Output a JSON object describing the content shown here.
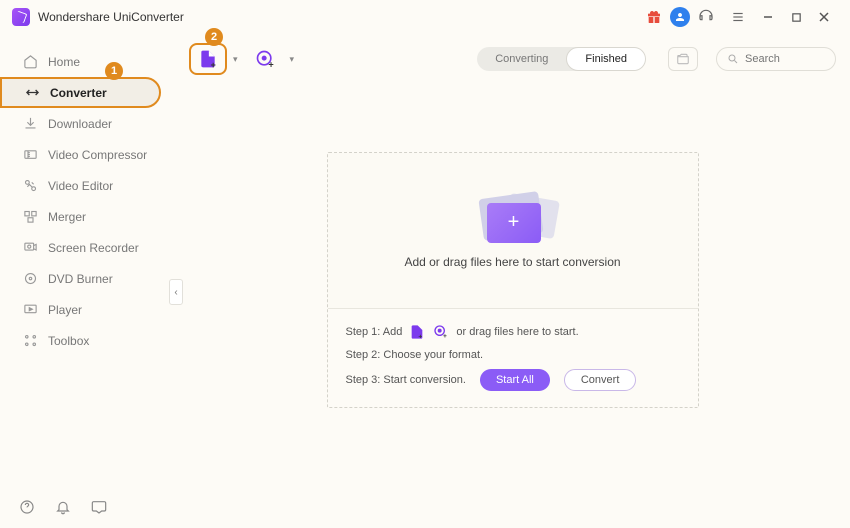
{
  "app": {
    "title": "Wondershare UniConverter"
  },
  "sidebar": {
    "items": [
      {
        "label": "Home",
        "icon": "home"
      },
      {
        "label": "Converter",
        "icon": "converter",
        "active": true
      },
      {
        "label": "Downloader",
        "icon": "downloader"
      },
      {
        "label": "Video Compressor",
        "icon": "compressor"
      },
      {
        "label": "Video Editor",
        "icon": "editor"
      },
      {
        "label": "Merger",
        "icon": "merger"
      },
      {
        "label": "Screen Recorder",
        "icon": "recorder"
      },
      {
        "label": "DVD Burner",
        "icon": "dvd"
      },
      {
        "label": "Player",
        "icon": "player"
      },
      {
        "label": "Toolbox",
        "icon": "toolbox"
      }
    ]
  },
  "tabs": {
    "converting": "Converting",
    "finished": "Finished"
  },
  "search": {
    "placeholder": "Search"
  },
  "dropzone": {
    "main_text": "Add or drag files here to start conversion"
  },
  "steps": {
    "s1a": "Step 1: Add",
    "s1b": "or drag files here to start.",
    "s2": "Step 2: Choose your format.",
    "s3": "Step 3: Start conversion.",
    "start_all": "Start All",
    "convert": "Convert"
  },
  "badges": {
    "b1": "1",
    "b2": "2"
  }
}
